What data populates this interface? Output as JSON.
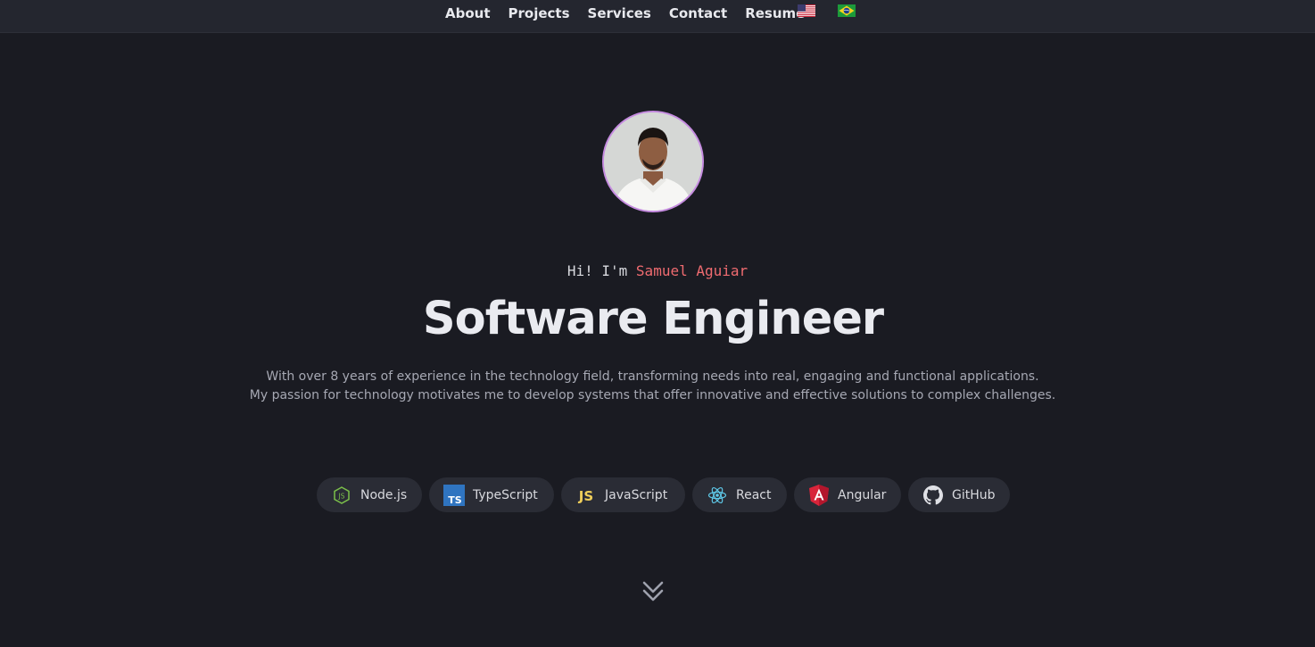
{
  "nav": {
    "links": [
      "About",
      "Projects",
      "Services",
      "Contact",
      "Resume"
    ],
    "languages": [
      {
        "icon": "us-flag-icon"
      },
      {
        "icon": "brazil-flag-icon"
      }
    ]
  },
  "hero": {
    "greeting_prefix": "Hi! I'm",
    "name": "Samuel Aguiar",
    "title": "Software Engineer",
    "description": [
      "With over 8 years of experience in the technology field, transforming needs into real, engaging and functional applications.",
      "My passion for technology motivates me to develop systems that offer innovative and effective solutions to complex challenges."
    ],
    "avatar_border_color": "#c58be0",
    "name_color": "#ef6b70"
  },
  "skills": [
    {
      "label": "Node.js",
      "icon": "nodejs-icon"
    },
    {
      "label": "TypeScript",
      "icon": "typescript-icon"
    },
    {
      "label": "JavaScript",
      "icon": "javascript-icon"
    },
    {
      "label": "React",
      "icon": "react-icon"
    },
    {
      "label": "Angular",
      "icon": "angular-icon"
    },
    {
      "label": "GitHub",
      "icon": "github-icon"
    }
  ],
  "scroll": {
    "icon": "chevron-double-down-icon"
  },
  "colors": {
    "background": "#1a1b22",
    "navbar": "#24262f",
    "pill": "#2a2c35"
  }
}
